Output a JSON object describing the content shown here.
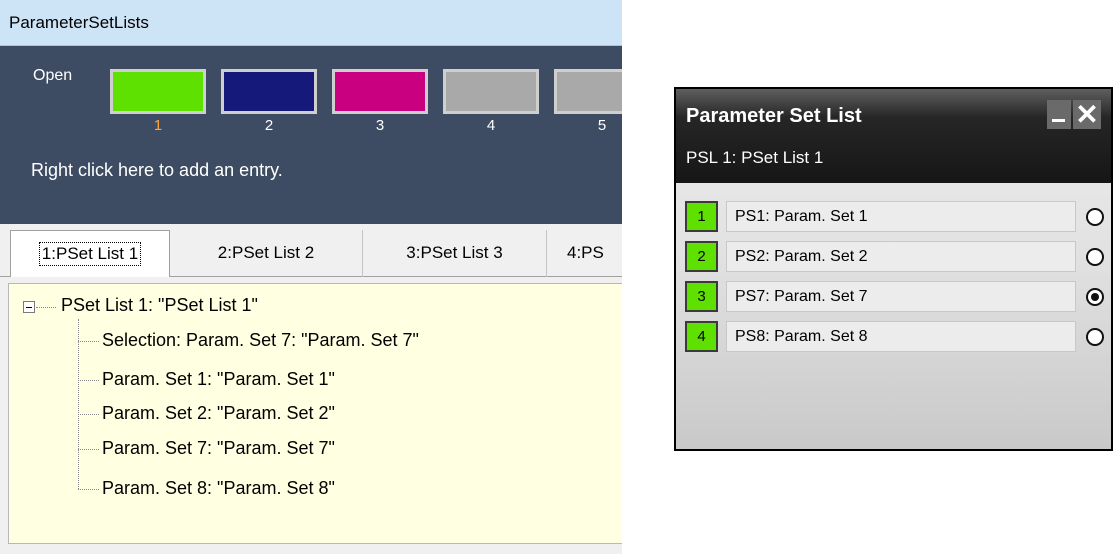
{
  "left_window": {
    "title": "ParameterSetLists",
    "open_label": "Open",
    "swatches": [
      {
        "number": "1",
        "color": "#5ee000",
        "active": true
      },
      {
        "number": "2",
        "color": "#15197a",
        "active": false
      },
      {
        "number": "3",
        "color": "#c90080",
        "active": false
      },
      {
        "number": "4",
        "color": "#a9a9a9",
        "active": false
      },
      {
        "number": "5",
        "color": "#a9a9a9",
        "active": false
      }
    ],
    "hint": "Right click here to add an entry.",
    "tabs": [
      "1:PSet List 1",
      "2:PSet List 2",
      "3:PSet List 3",
      "4:PS"
    ],
    "selected_tab": 0,
    "tree": {
      "root": "PSet List 1: \"PSet List 1\"",
      "children": [
        "Selection: Param. Set 7: \"Param. Set 7\"",
        "Param. Set 1: \"Param. Set 1\"",
        "Param. Set 2: \"Param. Set 2\"",
        "Param. Set 7: \"Param. Set 7\"",
        "Param. Set 8: \"Param. Set 8\""
      ]
    }
  },
  "right_window": {
    "title": "Parameter Set List",
    "subtitle": "PSL 1: PSet List 1",
    "rows": [
      {
        "number": "1",
        "name": "PS1: Param. Set 1",
        "selected": false
      },
      {
        "number": "2",
        "name": "PS2: Param. Set 2",
        "selected": false
      },
      {
        "number": "3",
        "name": "PS7: Param. Set 7",
        "selected": true
      },
      {
        "number": "4",
        "name": "PS8: Param. Set 8",
        "selected": false
      }
    ],
    "minimize_icon": "minimize-icon",
    "close_icon": "close-icon"
  }
}
